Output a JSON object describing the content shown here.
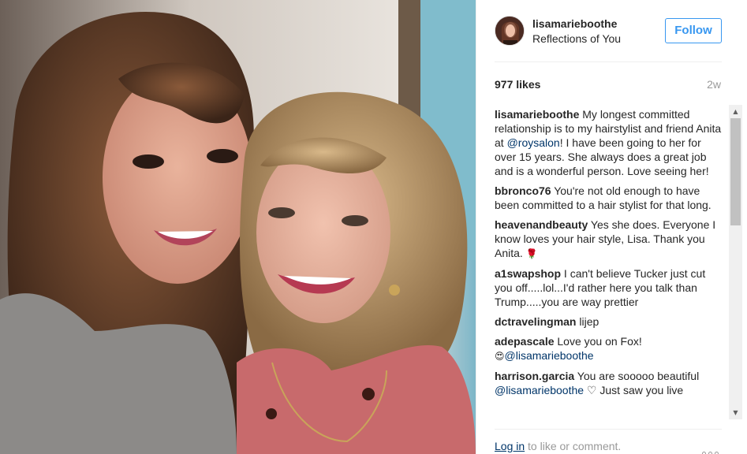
{
  "post": {
    "username": "lisamarieboothe",
    "location": "Reflections of You",
    "follow_label": "Follow",
    "likes": "977 likes",
    "time_ago": "2w"
  },
  "comments": [
    {
      "author": "lisamarieboothe",
      "text_before": " My longest committed relationship is to my hairstylist and friend Anita at ",
      "mention": "@roysalon",
      "text_after": "! I have been going to her for over 15 years. She always does a great job and is a wonderful person. Love seeing her!"
    },
    {
      "author": "bbronco76",
      "text": " You're not old enough to have been committed to a hair stylist for that long."
    },
    {
      "author": "heavenandbeauty",
      "text": " Yes she does. Everyone I know loves your hair style, Lisa. Thank you Anita. ",
      "emoji": "🌹"
    },
    {
      "author": "a1swapshop",
      "text": " I can't believe Tucker just cut you off.....lol...I'd rather here you talk than Trump.....you are way prettier"
    },
    {
      "author": "dctravelingman",
      "text": " lijep"
    },
    {
      "author": "adepascale",
      "text": " Love you on Fox! ",
      "emoji": "😍",
      "mention": "@lisamarieboothe"
    },
    {
      "author": "harrison.garcia",
      "text": " You are sooooo beautiful ",
      "mention": "@lisamarieboothe",
      "text_after": " ♡ Just saw you live"
    }
  ],
  "footer": {
    "login": "Log in",
    "rest": " to like or comment."
  },
  "icons": {
    "more": "more-options-icon",
    "scroll_up": "scroll-up-arrow-icon",
    "scroll_down": "scroll-down-arrow-icon"
  }
}
